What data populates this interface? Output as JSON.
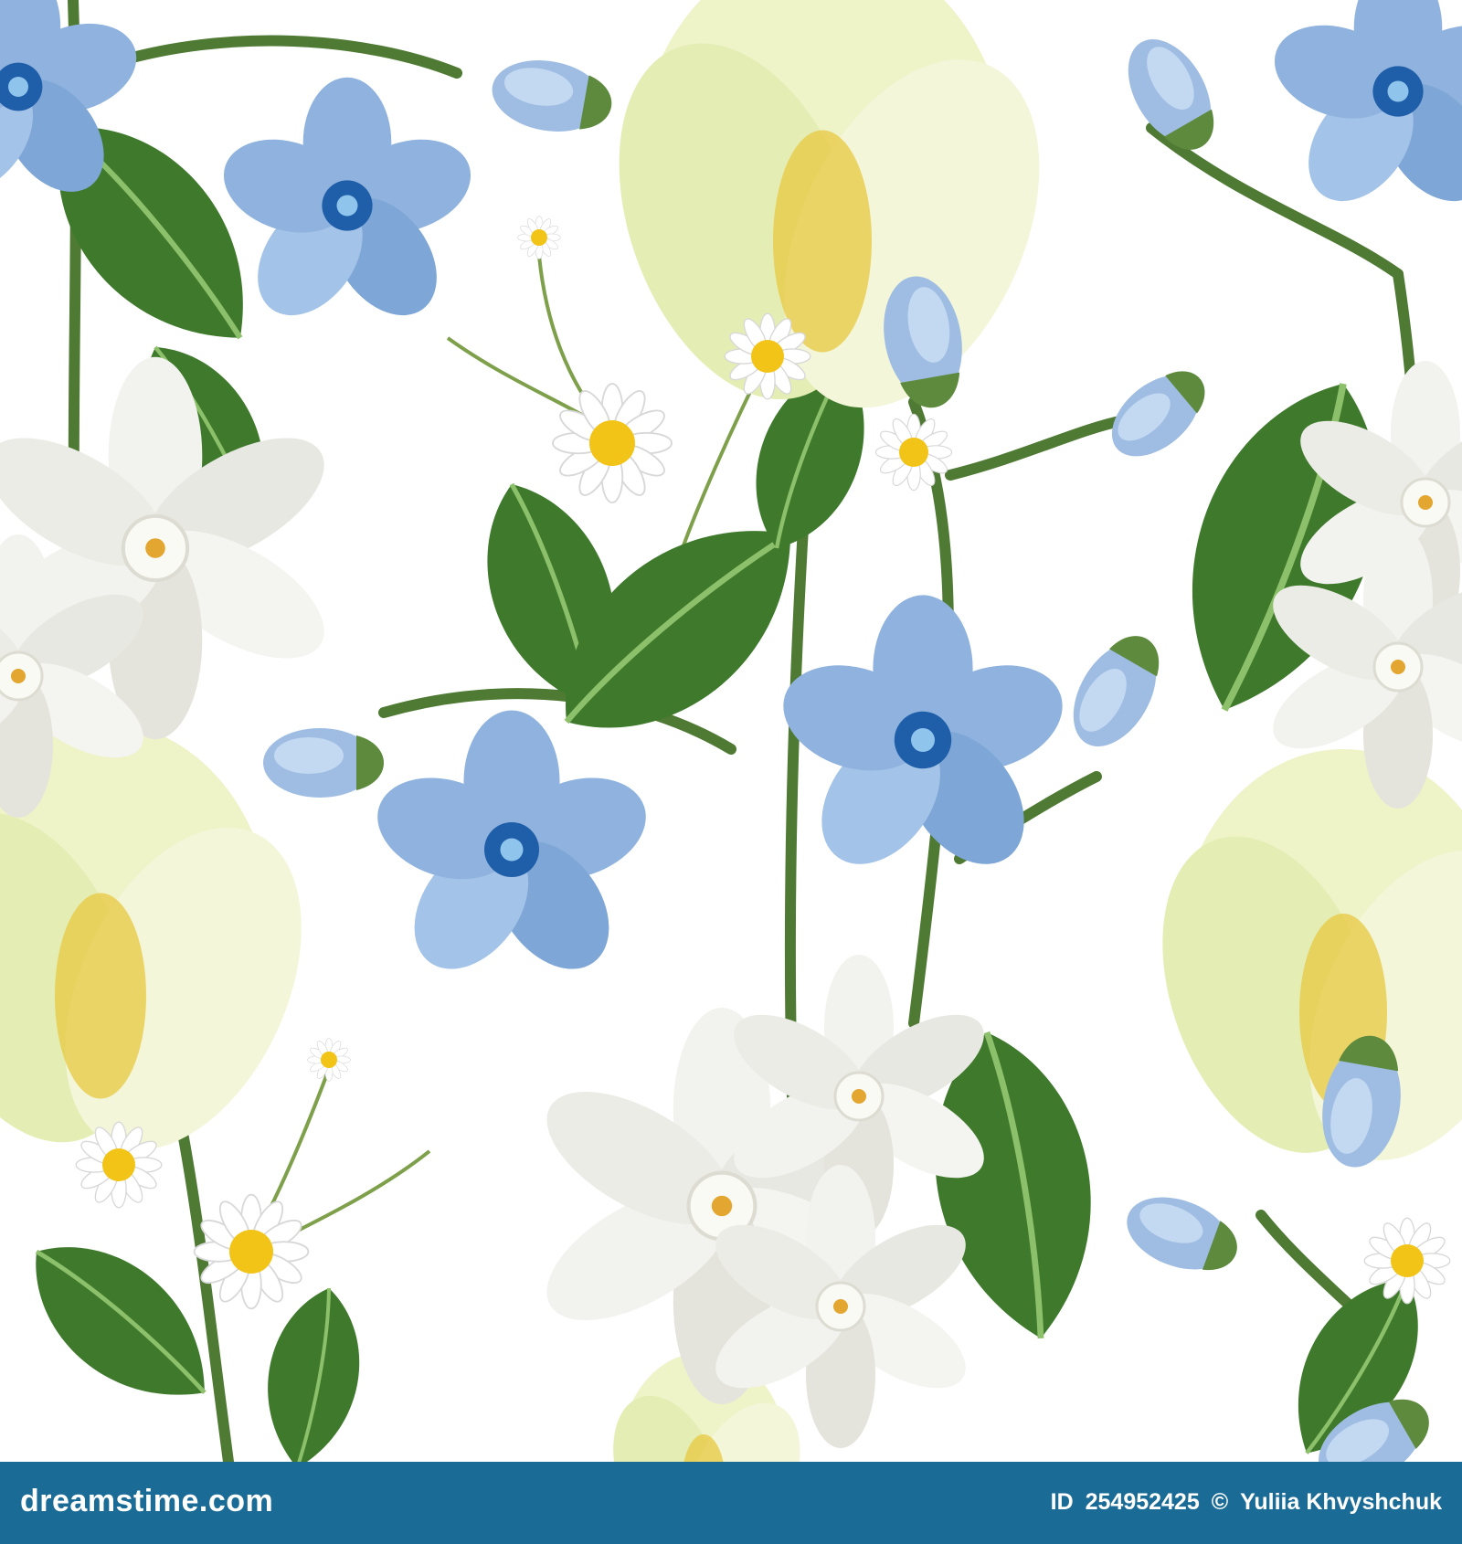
{
  "image": {
    "subject": "seamless floral pattern",
    "colors": {
      "background": "#ffffff",
      "leaf_dark": "#3f7a2c",
      "leaf_light": "#8cc06a",
      "stem": "#4f7a33",
      "blue_flower": "#8fb3de",
      "blue_center": "#1f5ea8",
      "tulip": "#eef3c8",
      "tulip_center": "#e8c840",
      "narcissus": "#f2f2ee",
      "daisy_center": "#f2c418",
      "footer_bar": "#1b6b97"
    }
  },
  "footer": {
    "brand": "dreamstime.com",
    "id_label": "ID",
    "id_value": "254952425",
    "copyright_symbol": "©",
    "author": "Yuliia Khvyshchuk"
  }
}
